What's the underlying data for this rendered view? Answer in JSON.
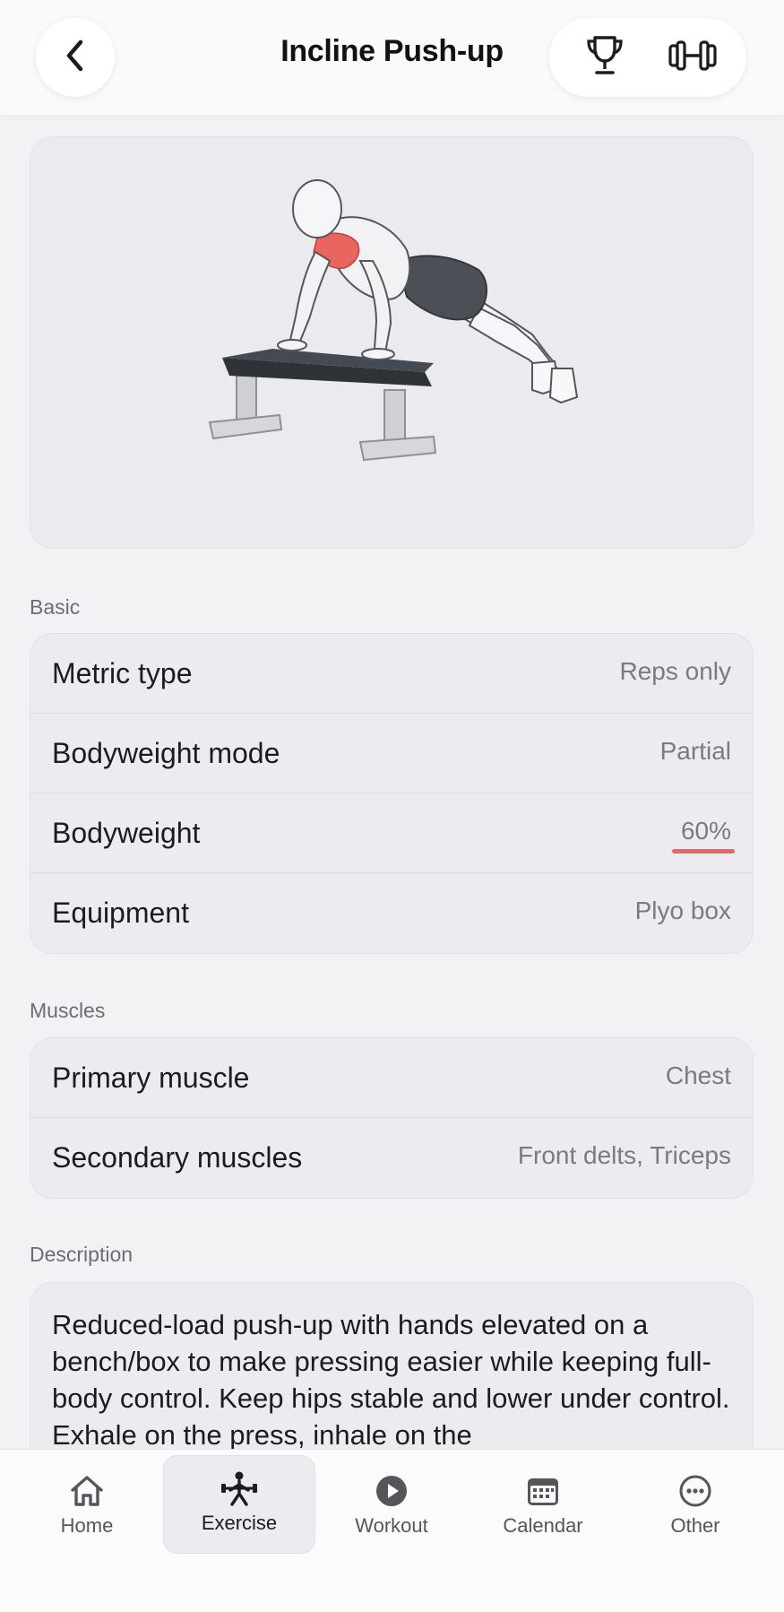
{
  "header": {
    "title": "Incline Push-up",
    "back_icon": "chevron-left-icon",
    "actions": [
      {
        "icon": "trophy-icon"
      },
      {
        "icon": "dumbbell-icon"
      }
    ]
  },
  "illustration": {
    "subject": "push-up-figure",
    "highlighted_muscle_color": "#e8665e"
  },
  "sections": {
    "basic": {
      "label": "Basic",
      "rows": [
        {
          "label": "Metric type",
          "value": "Reps only"
        },
        {
          "label": "Bodyweight mode",
          "value": "Partial"
        },
        {
          "label": "Bodyweight",
          "value": "60%"
        },
        {
          "label": "Equipment",
          "value": "Plyo box"
        }
      ]
    },
    "muscles": {
      "label": "Muscles",
      "rows": [
        {
          "label": "Primary muscle",
          "value": "Chest"
        },
        {
          "label": "Secondary muscles",
          "value": "Front delts, Triceps"
        }
      ]
    },
    "description": {
      "label": "Description",
      "text": "Reduced-load push-up with hands elevated on a bench/box to make pressing easier while keeping full-body control. Keep hips stable and lower under control. Exhale on the press, inhale on the"
    }
  },
  "tabbar": {
    "tabs": [
      {
        "label": "Home",
        "icon": "home-icon"
      },
      {
        "label": "Exercise",
        "icon": "exercise-icon"
      },
      {
        "label": "Workout",
        "icon": "play-icon"
      },
      {
        "label": "Calendar",
        "icon": "calendar-icon"
      },
      {
        "label": "Other",
        "icon": "more-icon"
      }
    ],
    "active": "Exercise"
  },
  "colors": {
    "accent": "#e8665e",
    "background": "#f2f2f5",
    "card": "#ececf0"
  }
}
